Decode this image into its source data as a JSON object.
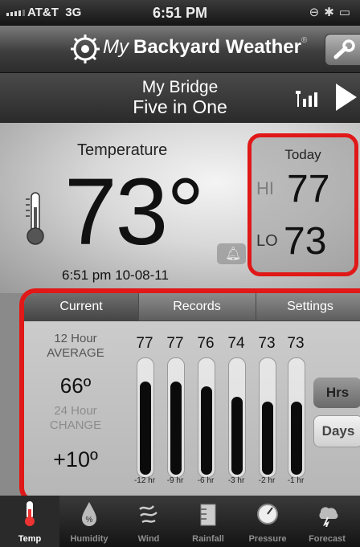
{
  "status_bar": {
    "carrier": "AT&T",
    "network": "3G",
    "time": "6:51 PM"
  },
  "nav": {
    "app_title_my": "My",
    "app_title_rest": "Backyard Weather",
    "trademark": "®"
  },
  "station": {
    "name": "My Bridge",
    "model": "Five in One"
  },
  "current": {
    "temperature_label": "Temperature",
    "temperature_value": "73°",
    "timestamp": "6:51 pm 10-08-11",
    "today": {
      "label": "Today",
      "hi_label": "HI",
      "hi_value": "77",
      "lo_label": "LO",
      "lo_value": "73"
    }
  },
  "history": {
    "tabs": [
      {
        "label": "Current"
      },
      {
        "label": "Records"
      },
      {
        "label": "Settings"
      }
    ],
    "avg_label": "12 Hour AVERAGE",
    "avg_value": "66º",
    "change_label": "24 Hour CHANGE",
    "change_value": "+10º",
    "bars": [
      {
        "value": "77",
        "time": "-12 hr",
        "level": 77
      },
      {
        "value": "77",
        "time": "-9 hr",
        "level": 77
      },
      {
        "value": "76",
        "time": "-6 hr",
        "level": 76
      },
      {
        "value": "74",
        "time": "-3 hr",
        "level": 74
      },
      {
        "value": "73",
        "time": "-2 hr",
        "level": 73
      },
      {
        "value": "73",
        "time": "-1 hr",
        "level": 73
      }
    ],
    "hrs_button": "Hrs",
    "days_button": "Days"
  },
  "tabbar": {
    "items": [
      {
        "label": "Temp",
        "icon": "thermometer-icon"
      },
      {
        "label": "Humidity",
        "icon": "humidity-drop-icon"
      },
      {
        "label": "Wind",
        "icon": "wind-icon"
      },
      {
        "label": "Rainfall",
        "icon": "rain-gauge-icon"
      },
      {
        "label": "Pressure",
        "icon": "pressure-gauge-icon"
      },
      {
        "label": "Forecast",
        "icon": "forecast-icon"
      }
    ]
  }
}
